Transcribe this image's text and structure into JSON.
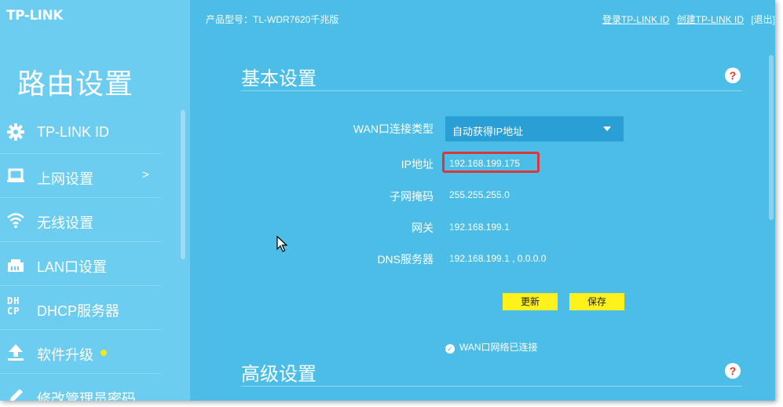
{
  "header": {
    "logo": "TP-LINK",
    "model": "产品型号：TL-WDR7620千兆版",
    "login_link": "登录TP-LINK ID",
    "create_link": "创建TP-LINK ID",
    "logout_link": "[退出]"
  },
  "sidebar": {
    "title": "路由设置",
    "items": [
      {
        "label": "TP-LINK ID",
        "icon": "gear-icon"
      },
      {
        "label": "上网设置",
        "icon": "laptop-icon",
        "arrow": ">"
      },
      {
        "label": "无线设置",
        "icon": "wifi-icon"
      },
      {
        "label": "LAN口设置",
        "icon": "lan-port-icon"
      },
      {
        "label": "DHCP服务器",
        "icon": "dhcp-icon",
        "icon_text": "DHCP"
      },
      {
        "label": "软件升级",
        "icon": "upload-icon"
      },
      {
        "label": "修改管理员密码",
        "icon": "pencil-icon"
      }
    ]
  },
  "basic": {
    "title": "基本设置",
    "help": "?",
    "wan_type_label": "WAN口连接类型",
    "wan_type_value": "自动获得IP地址",
    "ip_label": "IP地址",
    "ip_value": "192.168.199.175",
    "mask_label": "子网掩码",
    "mask_value": "255.255.255.0",
    "gateway_label": "网关",
    "gateway_value": "192.168.199.1",
    "dns_label": "DNS服务器",
    "dns_value": "192.168.199.1 , 0.0.0.0",
    "refresh_button": "更新",
    "save_button": "保存",
    "status": "WAN口网络已连接"
  },
  "advanced": {
    "title": "高级设置",
    "help": "?"
  },
  "colors": {
    "main_bg": "#4cbde6",
    "sidebar_bg": "#6ccdf0",
    "button": "#fff21c",
    "highlight": "#d8383a",
    "help_mark": "#e0372a"
  }
}
